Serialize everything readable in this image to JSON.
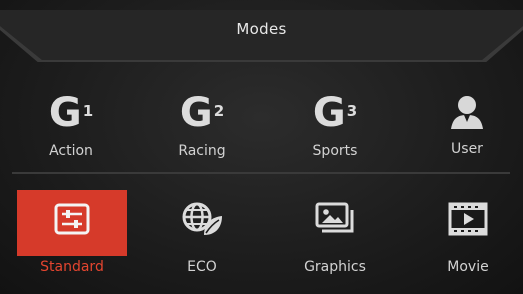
{
  "window": {
    "title": "Modes"
  },
  "modes_row1": [
    {
      "id": "action",
      "icon": "g1-icon",
      "glyph": "G",
      "sup": "1",
      "label": "Action"
    },
    {
      "id": "racing",
      "icon": "g2-icon",
      "glyph": "G",
      "sup": "2",
      "label": "Racing"
    },
    {
      "id": "sports",
      "icon": "g3-icon",
      "glyph": "G",
      "sup": "3",
      "label": "Sports"
    },
    {
      "id": "user",
      "icon": "user-icon",
      "label": "User"
    }
  ],
  "modes_row2": [
    {
      "id": "standard",
      "icon": "sliders-icon",
      "label": "Standard",
      "selected": true
    },
    {
      "id": "eco",
      "icon": "globe-leaf-icon",
      "label": "ECO"
    },
    {
      "id": "graphics",
      "icon": "picture-stack-icon",
      "label": "Graphics"
    },
    {
      "id": "movie",
      "icon": "film-play-icon",
      "label": "Movie"
    }
  ],
  "colors": {
    "accent": "#d63a2a",
    "selected_text": "#e4452f",
    "text": "#d2d2d2"
  }
}
